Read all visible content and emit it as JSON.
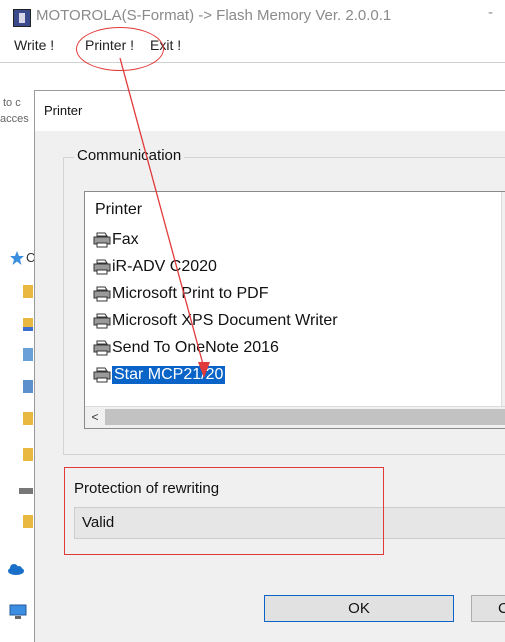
{
  "window": {
    "title": "MOTOROLA(S-Format) -> Flash Memory Ver. 2.0.0.1",
    "title_right": "-"
  },
  "menu": {
    "write": "Write !",
    "printer": "Printer !",
    "exit": "Exit !"
  },
  "background": {
    "fragment_top": "to c",
    "fragment_access": "acces"
  },
  "dialog": {
    "title": "Printer",
    "communication": {
      "legend": "Communication",
      "list_header": "Printer",
      "printers": [
        {
          "name": "Fax",
          "selected": false
        },
        {
          "name": "iR-ADV C2020",
          "selected": false
        },
        {
          "name": "Microsoft Print to PDF",
          "selected": false
        },
        {
          "name": "Microsoft XPS Document Writer",
          "selected": false
        },
        {
          "name": "Send To OneNote 2016",
          "selected": false
        },
        {
          "name": "Star MCP21/20",
          "selected": true
        }
      ],
      "scroll_left": "<"
    },
    "protection": {
      "legend": "Protection of rewriting",
      "value": "Valid"
    },
    "buttons": {
      "ok": "OK",
      "cancel": "C"
    }
  },
  "colors": {
    "selection": "#0a64c8",
    "annotation": "#e03a3a"
  },
  "icons": {
    "app": "app-chip-icon",
    "printer": "printer-icon",
    "quick_access": "star-icon",
    "folder": "folder-icon",
    "onedrive": "cloud-icon",
    "this_pc": "computer-icon"
  }
}
